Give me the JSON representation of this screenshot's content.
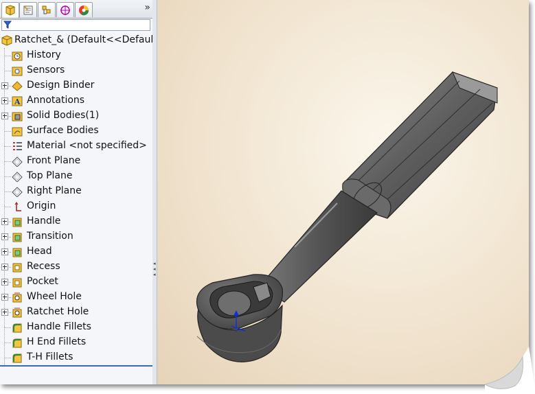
{
  "tree": {
    "root": "Ratchet_&  (Default<<Default",
    "items": [
      {
        "label": "History",
        "icon": "history-folder-icon",
        "expandable": false
      },
      {
        "label": "Sensors",
        "icon": "sensors-folder-icon",
        "expandable": false
      },
      {
        "label": "Design Binder",
        "icon": "design-binder-icon",
        "expandable": true
      },
      {
        "label": "Annotations",
        "icon": "annotations-icon",
        "expandable": true
      },
      {
        "label": "Solid Bodies(1)",
        "icon": "solid-bodies-icon",
        "expandable": true
      },
      {
        "label": "Surface Bodies",
        "icon": "surface-bodies-icon",
        "expandable": false
      },
      {
        "label": "Material <not specified>",
        "icon": "material-icon",
        "expandable": false
      },
      {
        "label": "Front Plane",
        "icon": "plane-icon",
        "expandable": false
      },
      {
        "label": "Top Plane",
        "icon": "plane-icon",
        "expandable": false
      },
      {
        "label": "Right Plane",
        "icon": "plane-icon",
        "expandable": false
      },
      {
        "label": "Origin",
        "icon": "origin-icon",
        "expandable": false
      },
      {
        "label": "Handle",
        "icon": "extrude-icon",
        "expandable": true
      },
      {
        "label": "Transition",
        "icon": "extrude-icon",
        "expandable": true
      },
      {
        "label": "Head",
        "icon": "extrude-icon",
        "expandable": true
      },
      {
        "label": "Recess",
        "icon": "cut-icon",
        "expandable": true
      },
      {
        "label": "Pocket",
        "icon": "cut-icon",
        "expandable": true
      },
      {
        "label": "Wheel Hole",
        "icon": "hole-icon",
        "expandable": true
      },
      {
        "label": "Ratchet Hole",
        "icon": "hole-icon",
        "expandable": true
      },
      {
        "label": "Handle Fillets",
        "icon": "fillet-icon",
        "expandable": false
      },
      {
        "label": "H End Fillets",
        "icon": "fillet-icon",
        "expandable": false
      },
      {
        "label": "T-H Fillets",
        "icon": "fillet-icon",
        "expandable": false
      }
    ]
  },
  "tabs": [
    "feature-manager-tab",
    "property-manager-tab",
    "configuration-manager-tab",
    "dimxpert-tab",
    "display-manager-tab"
  ],
  "more_label": "»",
  "colors": {
    "panel": "#f4f6f9",
    "model": "#5a5a5a",
    "background": "#f3e7d4"
  }
}
